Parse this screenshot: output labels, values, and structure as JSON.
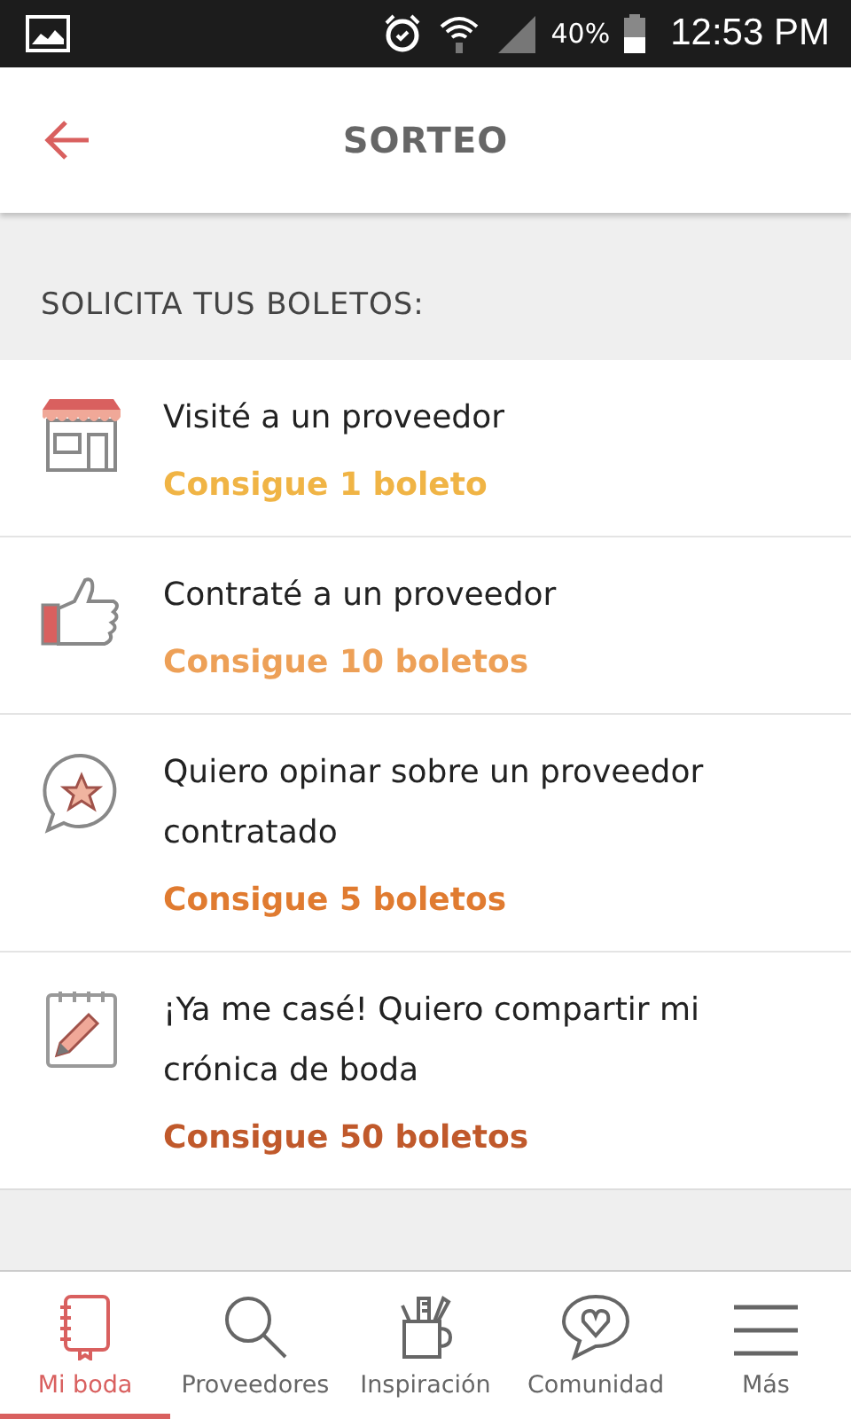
{
  "status_bar": {
    "battery": "40%",
    "time": "12:53 PM"
  },
  "header": {
    "title": "SORTEO"
  },
  "section": {
    "title": "SOLICITA TUS BOLETOS:"
  },
  "items": [
    {
      "kind": "store",
      "title": "Visité a un proveedor",
      "reward": "Consigue 1 boleto",
      "color": "#f0b445"
    },
    {
      "kind": "thumb",
      "title": "Contraté a un proveedor",
      "reward": "Consigue 10 boletos",
      "color": "#eda057"
    },
    {
      "kind": "review",
      "title": "Quiero opinar sobre un proveedor contratado",
      "reward": "Consigue 5 boletos",
      "color": "#e07b30"
    },
    {
      "kind": "notepad",
      "title": "¡Ya me casé! Quiero compartir mi crónica de boda",
      "reward": "Consigue 50 boletos",
      "color": "#c0592b"
    }
  ],
  "tabs": [
    {
      "kind": "notebook",
      "label": "Mi boda",
      "selected": true
    },
    {
      "kind": "search",
      "label": "Proveedores",
      "selected": false
    },
    {
      "kind": "mug",
      "label": "Inspiración",
      "selected": false
    },
    {
      "kind": "chat",
      "label": "Comunidad",
      "selected": false
    },
    {
      "kind": "menu",
      "label": "Más",
      "selected": false
    }
  ]
}
